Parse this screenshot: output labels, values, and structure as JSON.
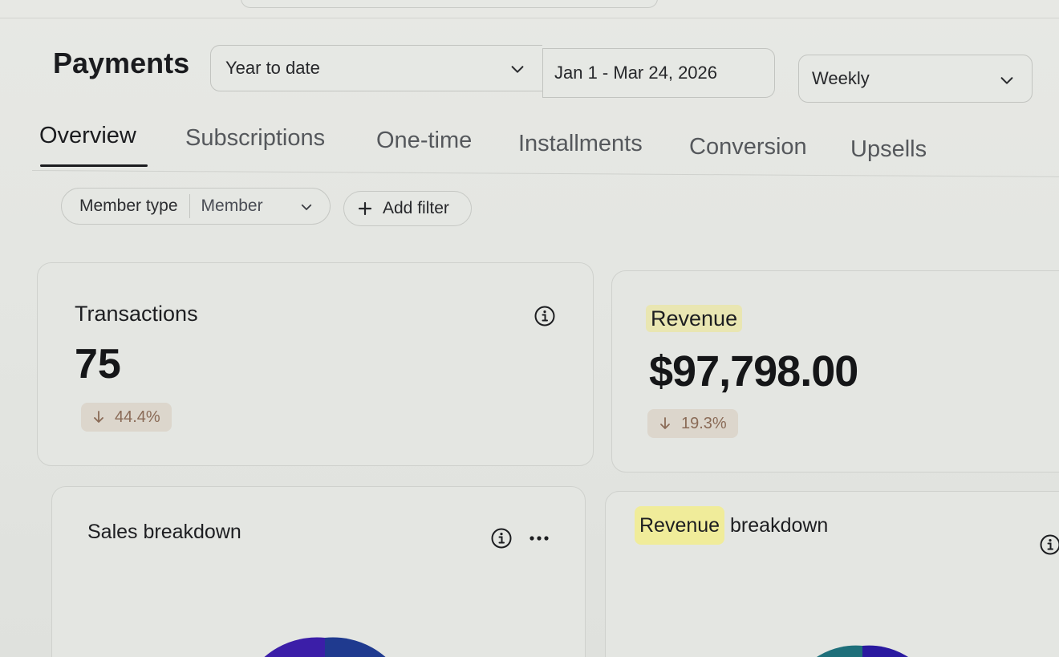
{
  "header": {
    "title": "Payments",
    "range_select": {
      "value": "Year to date"
    },
    "date_range": {
      "value": "Jan 1 - Mar 24, 2026"
    },
    "interval_select": {
      "value": "Weekly"
    }
  },
  "tabs": [
    {
      "label": "Overview",
      "active": true
    },
    {
      "label": "Subscriptions"
    },
    {
      "label": "One-time"
    },
    {
      "label": "Installments"
    },
    {
      "label": "Conversion"
    },
    {
      "label": "Upsells"
    }
  ],
  "filters": {
    "member_type": {
      "label": "Member type",
      "value": "Member"
    },
    "add_filter_label": "Add filter"
  },
  "cards": {
    "transactions": {
      "title": "Transactions",
      "value": "75",
      "change": "44.4%",
      "direction": "down"
    },
    "revenue": {
      "title": "Revenue",
      "value": "$97,798.00",
      "change": "19.3%",
      "direction": "down"
    },
    "sales_breakdown": {
      "title": "Sales breakdown"
    },
    "revenue_breakdown": {
      "title_highlight": "Revenue",
      "title_rest": "breakdown"
    }
  },
  "colors": {
    "negative_change": "#8a6b57",
    "badge_bg": "#dcd6cc",
    "highlight": "#f0ec9a",
    "pie_primary": "#3b1ea8",
    "pie_secondary": "#1f3a8f",
    "pie_teal": "#1e6f7a"
  },
  "icons": {
    "chevron": "chevron-down-icon",
    "info": "info-icon",
    "more": "more-icon",
    "plus": "plus-icon",
    "arrow_down": "arrow-down-icon"
  }
}
